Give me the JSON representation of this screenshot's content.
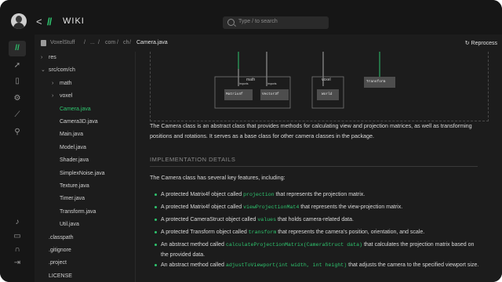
{
  "app": {
    "title": "WIKI",
    "logo_text": "//",
    "back_glyph": "<",
    "search_placeholder": "Type / to search"
  },
  "rail": {
    "items": [
      {
        "icon": "wiki-icon",
        "glyph": "//",
        "active": true
      },
      {
        "icon": "rocket-icon",
        "glyph": "➚",
        "active": false
      },
      {
        "icon": "book-icon",
        "glyph": "▯",
        "active": false
      },
      {
        "icon": "settings-icon",
        "glyph": "⚙",
        "active": false
      },
      {
        "icon": "chart-icon",
        "glyph": "⟋",
        "active": false
      },
      {
        "icon": "hierarchy-icon",
        "glyph": "⚲",
        "active": false
      },
      {
        "icon": "bell-icon",
        "glyph": "♪",
        "active": false
      },
      {
        "icon": "monitor-icon",
        "glyph": "▭",
        "active": false
      },
      {
        "icon": "headset-icon",
        "glyph": "∩",
        "active": false
      },
      {
        "icon": "logout-icon",
        "glyph": "⇥",
        "active": false
      }
    ]
  },
  "breadcrumb": {
    "items": [
      "VoxelStuff",
      "/",
      "...",
      "/",
      "com",
      "/",
      "ch",
      "/"
    ],
    "current": "Camera.java",
    "action": "Reprocess"
  },
  "tree": {
    "items": [
      {
        "label": "res",
        "chevron": "›",
        "indent": 0,
        "active": false
      },
      {
        "label": "src/com/ch",
        "chevron": "⌄",
        "indent": 0,
        "active": false
      },
      {
        "label": "math",
        "chevron": "›",
        "indent": 1,
        "active": false
      },
      {
        "label": "voxel",
        "chevron": "›",
        "indent": 1,
        "active": false
      },
      {
        "label": "Camera.java",
        "chevron": "",
        "indent": 1,
        "active": true
      },
      {
        "label": "Camera3D.java",
        "chevron": "",
        "indent": 1,
        "active": false
      },
      {
        "label": "Main.java",
        "chevron": "",
        "indent": 1,
        "active": false
      },
      {
        "label": "Model.java",
        "chevron": "",
        "indent": 1,
        "active": false
      },
      {
        "label": "Shader.java",
        "chevron": "",
        "indent": 1,
        "active": false
      },
      {
        "label": "SimplexNoise.java",
        "chevron": "",
        "indent": 1,
        "active": false
      },
      {
        "label": "Texture.java",
        "chevron": "",
        "indent": 1,
        "active": false
      },
      {
        "label": "Timer.java",
        "chevron": "",
        "indent": 1,
        "active": false
      },
      {
        "label": "Transform.java",
        "chevron": "",
        "indent": 1,
        "active": false
      },
      {
        "label": "Util.java",
        "chevron": "",
        "indent": 1,
        "active": false
      },
      {
        "label": ".classpath",
        "chevron": "",
        "indent": 0,
        "active": false
      },
      {
        "label": ".gitignore",
        "chevron": "",
        "indent": 0,
        "active": false
      },
      {
        "label": ".project",
        "chevron": "",
        "indent": 0,
        "active": false
      },
      {
        "label": "LICENSE",
        "chevron": "",
        "indent": 0,
        "active": false
      }
    ]
  },
  "diagram": {
    "groups": [
      "math",
      "voxel"
    ],
    "edge_label": "imports",
    "nodes": [
      "Matrix4f",
      "Vector3f",
      "World",
      "Transform"
    ]
  },
  "content": {
    "intro": "The Camera class is an abstract class that provides methods for calculating view and projection matrices, as well as transforming positions and rotations. It serves as a base class for other camera classes in the package.",
    "section_title": "IMPLEMENTATION DETAILS",
    "section_intro": "The Camera class has several key features, including:",
    "bullets": [
      {
        "pre": "A protected Matrix4f object called ",
        "code": "projection",
        "post": " that represents the projection matrix."
      },
      {
        "pre": "A protected Matrix4f object called ",
        "code": "viewProjectionMat4",
        "post": " that represents the view-projection matrix."
      },
      {
        "pre": "A protected CameraStruct object called ",
        "code": "values",
        "post": " that holds camera-related data."
      },
      {
        "pre": "A protected Transform object called ",
        "code": "transform",
        "post": " that represents the camera's position, orientation, and scale."
      },
      {
        "pre": "An abstract method called ",
        "code": "calculateProjectionMatrix(CameraStruct data)",
        "post": " that calculates the projection matrix based on the provided data."
      },
      {
        "pre": "An abstract method called ",
        "code": "adjustToViewport(int width, int height)",
        "post": " that adjusts the camera to the specified viewport size."
      }
    ]
  },
  "colors": {
    "accent": "#2ec46e",
    "background": "#1c1c1c",
    "sidebar": "#161616"
  }
}
